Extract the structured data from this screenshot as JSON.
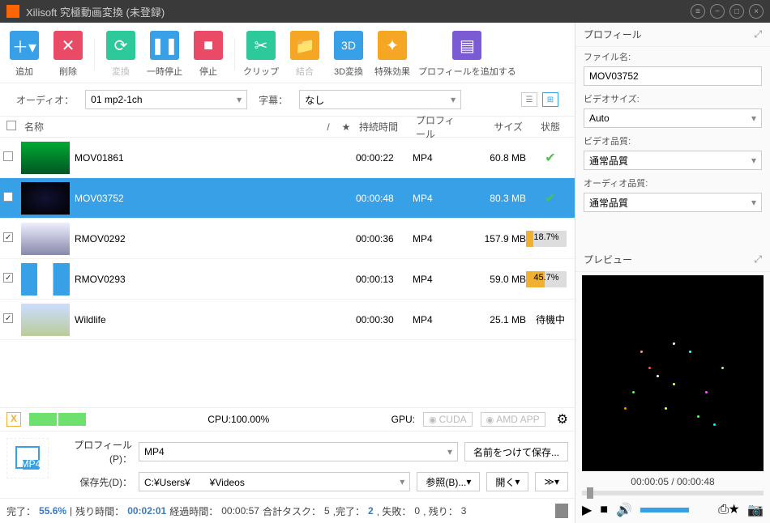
{
  "title": "Xilisoft 究極動画変換 (未登録)",
  "toolbar": {
    "add": "追加",
    "del": "削除",
    "conv": "変換",
    "pause": "一時停止",
    "stop": "停止",
    "clip": "クリップ",
    "merge": "結合",
    "conv3d": "3D変換",
    "sfx": "特殊効果",
    "addprof": "プロフィールを追加する"
  },
  "filters": {
    "audio_label": "オーディオ：",
    "audio_val": "01 mp2-1ch",
    "sub_label": "字幕：",
    "sub_val": "なし"
  },
  "th": {
    "name": "名称",
    "sort": "/",
    "star": "★",
    "dur": "持続時間",
    "prof": "プロフィール",
    "size": "サイズ",
    "stat": "状態"
  },
  "rows": [
    {
      "chk": false,
      "name": "MOV01861",
      "dur": "00:00:22",
      "prof": "MP4",
      "size": "60.8 MB",
      "stat": "ok",
      "sel": false
    },
    {
      "chk": false,
      "name": "MOV03752",
      "dur": "00:00:48",
      "prof": "MP4",
      "size": "80.3 MB",
      "stat": "ok",
      "sel": true
    },
    {
      "chk": true,
      "name": "RMOV0292",
      "dur": "00:00:36",
      "prof": "MP4",
      "size": "157.9 MB",
      "stat": "prog",
      "pct": "18.7%",
      "sel": false
    },
    {
      "chk": true,
      "name": "RMOV0293",
      "dur": "00:00:13",
      "prof": "MP4",
      "size": "59.0 MB",
      "stat": "prog",
      "pct": "45.7%",
      "sel": false
    },
    {
      "chk": true,
      "name": "Wildlife",
      "dur": "00:00:30",
      "prof": "MP4",
      "size": "25.1 MB",
      "stat": "wait",
      "sel": false
    }
  ],
  "wait_label": "待機中",
  "stat": {
    "cpu": "CPU:100.00%",
    "gpu_lbl": "GPU:",
    "cuda": "CUDA",
    "amd": "AMD APP"
  },
  "bottom": {
    "prof_lbl": "プロフィール(P)：",
    "prof_val": "MP4",
    "saveas": "名前をつけて保存...",
    "dest_lbl": "保存先(D)：",
    "dest_val": "C:¥Users¥　　¥Videos",
    "browse": "参照(B)...",
    "open": "開く",
    "more": "≫"
  },
  "statusbar": {
    "done_l": "完了：",
    "done_v": "55.6%",
    "remain_l": "残り時間：",
    "remain_v": "00:02:01",
    "elapsed_l": "経過時間：",
    "elapsed_v": "00:00:57",
    "tasks_l": "合計タスク：",
    "tasks_v": "5",
    "ok_l": ",完了：",
    "ok_v": "2",
    "fail_l": ", 失敗：",
    "fail_v": "0",
    "left_l": ", 残り：",
    "left_v": "3"
  },
  "profile": {
    "head": "プロフィール",
    "fname_l": "ファイル名:",
    "fname_v": "MOV03752",
    "vsize_l": "ビデオサイズ:",
    "vsize_v": "Auto",
    "vq_l": "ビデオ品質:",
    "vq_v": "通常品質",
    "aq_l": "オーディオ品質:",
    "aq_v": "通常品質"
  },
  "preview": {
    "head": "プレビュー",
    "time": "00:00:05 / 00:00:48"
  }
}
